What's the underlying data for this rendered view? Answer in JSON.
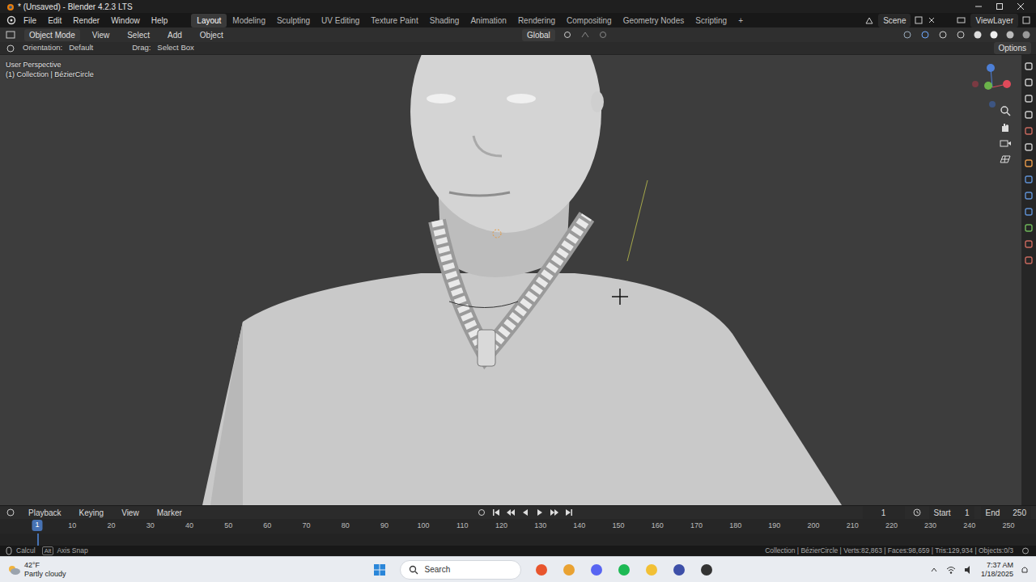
{
  "window": {
    "title": "* (Unsaved) - Blender 4.2.3 LTS"
  },
  "menus": [
    "File",
    "Edit",
    "Render",
    "Window",
    "Help"
  ],
  "workspaces": [
    {
      "label": "Layout",
      "selected": true
    },
    {
      "label": "Modeling",
      "selected": false
    },
    {
      "label": "Sculpting",
      "selected": false
    },
    {
      "label": "UV Editing",
      "selected": false
    },
    {
      "label": "Texture Paint",
      "selected": false
    },
    {
      "label": "Shading",
      "selected": false
    },
    {
      "label": "Animation",
      "selected": false
    },
    {
      "label": "Rendering",
      "selected": false
    },
    {
      "label": "Compositing",
      "selected": false
    },
    {
      "label": "Geometry Nodes",
      "selected": false
    },
    {
      "label": "Scripting",
      "selected": false
    }
  ],
  "add_workspace": "+",
  "scene": "Scene",
  "view_layer": "ViewLayer",
  "header": {
    "mode": "Object Mode",
    "menus": [
      "View",
      "Select",
      "Add",
      "Object"
    ],
    "transform": "Global"
  },
  "tool_settings": {
    "orientation_label": "Orientation:",
    "orientation": "Default",
    "drag_label": "Drag:",
    "drag": "Select Box",
    "options": "Options"
  },
  "viewport": {
    "view": "User Perspective",
    "object": "(1) Collection | BézierCircle"
  },
  "timeline": {
    "menus": [
      "Playback",
      "Keying",
      "View",
      "Marker"
    ],
    "current_frame": "1",
    "start_label": "Start",
    "start": "1",
    "end_label": "End",
    "end": "250",
    "playhead": "1",
    "ticks": [
      "10",
      "20",
      "30",
      "40",
      "50",
      "60",
      "70",
      "80",
      "90",
      "100",
      "110",
      "120",
      "130",
      "140",
      "150",
      "160",
      "170",
      "180",
      "190",
      "200",
      "210",
      "220",
      "230",
      "240",
      "250"
    ]
  },
  "status_bar": {
    "hints": [
      {
        "key": "",
        "label": "Calcul"
      },
      {
        "key": "Alt",
        "label": "Axis Snap"
      }
    ],
    "stats": "Collection | BézierCircle | Verts:82,863 | Faces:98,659 | Tris:129,934 | Objects:0/3"
  },
  "taskbar": {
    "weather_temp": "42°F",
    "weather_text": "Partly cloudy",
    "search": "Search",
    "time": "7:37 AM",
    "date": "1/18/2025"
  }
}
